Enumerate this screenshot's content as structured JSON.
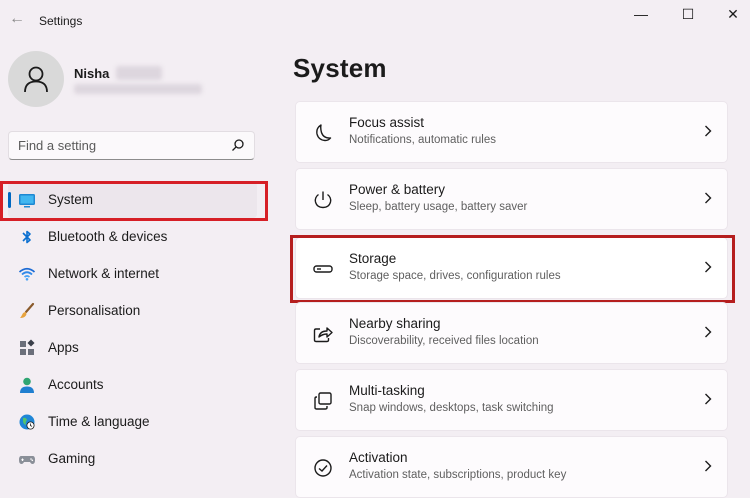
{
  "app": {
    "title": "Settings"
  },
  "window_controls": {
    "minimize": "—",
    "maximize": "☐",
    "close": "✕"
  },
  "user": {
    "name": "Nisha"
  },
  "search": {
    "placeholder": "Find a setting"
  },
  "sidebar": {
    "items": [
      {
        "label": "System",
        "icon": "system-icon",
        "active": true
      },
      {
        "label": "Bluetooth & devices",
        "icon": "bluetooth-icon"
      },
      {
        "label": "Network & internet",
        "icon": "wifi-icon"
      },
      {
        "label": "Personalisation",
        "icon": "brush-icon"
      },
      {
        "label": "Apps",
        "icon": "apps-icon"
      },
      {
        "label": "Accounts",
        "icon": "person-icon"
      },
      {
        "label": "Time & language",
        "icon": "globe-icon"
      },
      {
        "label": "Gaming",
        "icon": "gamepad-icon"
      }
    ]
  },
  "main": {
    "title": "System",
    "cards": [
      {
        "title": "Focus assist",
        "subtitle": "Notifications, automatic rules",
        "icon": "moon-icon"
      },
      {
        "title": "Power & battery",
        "subtitle": "Sleep, battery usage, battery saver",
        "icon": "power-icon"
      },
      {
        "title": "Storage",
        "subtitle": "Storage space, drives, configuration rules",
        "icon": "storage-drive-icon"
      },
      {
        "title": "Nearby sharing",
        "subtitle": "Discoverability, received files location",
        "icon": "share-icon"
      },
      {
        "title": "Multi-tasking",
        "subtitle": "Snap windows, desktops, task switching",
        "icon": "multitask-icon"
      },
      {
        "title": "Activation",
        "subtitle": "Activation state, subscriptions, product key",
        "icon": "check-circle-icon"
      }
    ]
  },
  "colors": {
    "accent": "#0067c0",
    "annotation_red": "#d61f26",
    "background": "#f3eef3"
  }
}
